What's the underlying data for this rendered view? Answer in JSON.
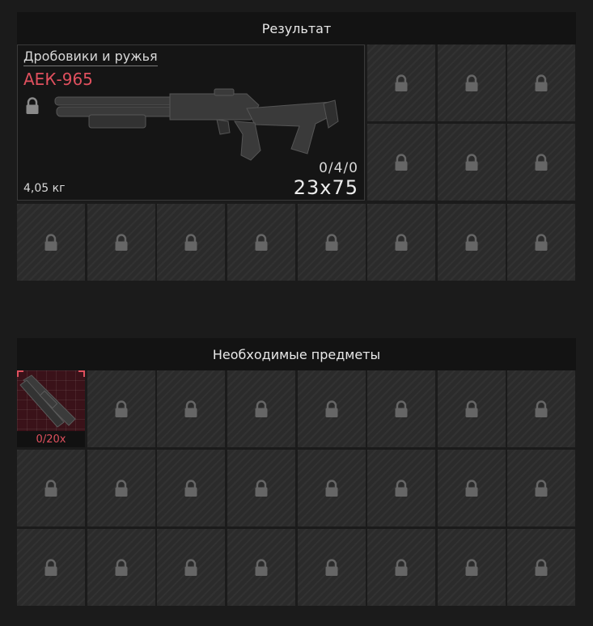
{
  "result": {
    "header": "Результат",
    "item": {
      "category": "Дробовики и ружья",
      "name": "АЕК-965",
      "weight": "4,05 кг",
      "ammo_count": "0/4/0",
      "caliber": "23x75",
      "locked": true
    }
  },
  "required": {
    "header": "Необходимые предметы",
    "item": {
      "count": "0/20x"
    }
  },
  "colors": {
    "accent": "#e0505e",
    "panel_bg": "#131313",
    "cell_bg": "#2b2b2b",
    "page_bg": "#1b1b1b"
  },
  "icons": {
    "lock": "lock-icon",
    "weapon": "shotgun-icon",
    "required": "shotgun-barrel-icon"
  }
}
